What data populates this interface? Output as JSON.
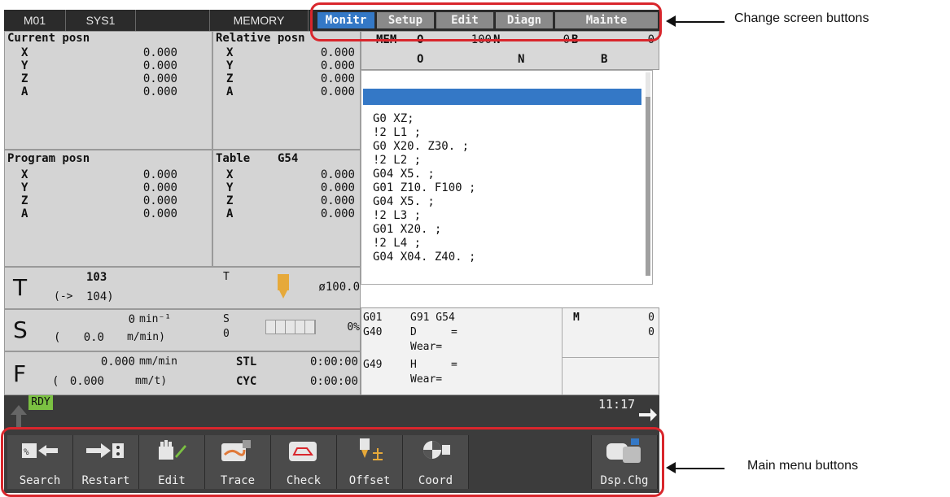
{
  "topbar": {
    "part": "M01",
    "system": "SYS1",
    "mode": "MEMORY",
    "screen_buttons": [
      "Monitr",
      "Setup",
      "Edit",
      "Diagn",
      "Mainte"
    ],
    "active_screen": "Monitr"
  },
  "current_posn": {
    "title": "Current posn",
    "axes": [
      "X",
      "Y",
      "Z",
      "A"
    ],
    "values": [
      "0.000",
      "0.000",
      "0.000",
      "0.000"
    ]
  },
  "relative_posn": {
    "title": "Relative posn",
    "axes": [
      "X",
      "Y",
      "Z",
      "A"
    ],
    "values": [
      "0.000",
      "0.000",
      "0.000",
      "0.000"
    ]
  },
  "program_posn": {
    "title": "Program posn",
    "axes": [
      "X",
      "Y",
      "Z",
      "A"
    ],
    "values": [
      "0.000",
      "0.000",
      "0.000",
      "0.000"
    ]
  },
  "table": {
    "title": "Table",
    "coord": "G54",
    "axes": [
      "X",
      "Y",
      "Z",
      "A"
    ],
    "values": [
      "0.000",
      "0.000",
      "0.000",
      "0.000"
    ]
  },
  "mem_header": {
    "mem": "MEM",
    "o1": "O",
    "o1_val": "100",
    "n1": "N",
    "n1_val": "0",
    "b1": "B",
    "b1_val": "0",
    "o2": "O",
    "n2": "N",
    "b2": "B"
  },
  "program_lines": [
    "G0 XZ;",
    "!2 L1 ;",
    "G0 X20. Z30. ;",
    "!2 L2 ;",
    "G04 X5. ;",
    "G01 Z10. F100 ;",
    "G04 X5. ;",
    "!2 L3 ;",
    "G01 X20. ;",
    "!2 L4 ;",
    "G04 X04. Z40. ;"
  ],
  "tool": {
    "letter": "T",
    "number": "103",
    "arrow": "(->",
    "next": "104)",
    "t_label": "T",
    "diameter": "ø100.0"
  },
  "spindle": {
    "letter": "S",
    "speed": "0",
    "unit": "min⁻¹",
    "paren_open": "(",
    "surface": "0.0",
    "surface_unit": "m/min)",
    "s_label": "S",
    "s_value": "0",
    "load": "0%"
  },
  "feed": {
    "letter": "F",
    "rate": "0.000",
    "rate_unit": "mm/min",
    "paren_open": "(",
    "per_rev": "0.000",
    "per_rev_unit": "mm/t)",
    "stl_label": "STL",
    "stl_time": "0:00:00",
    "cyc_label": "CYC",
    "cyc_time": "0:00:00"
  },
  "modal": {
    "g1": "G01",
    "g2": "G91 G54",
    "g40": "G40",
    "d": "D",
    "eq1": "=",
    "wear1": "Wear=",
    "g49": "G49",
    "h": "H",
    "eq2": "=",
    "wear2": "Wear=",
    "m": "M",
    "m1": "0",
    "m2": "0"
  },
  "status": {
    "ready": "RDY",
    "time": "11:17"
  },
  "menu": [
    "Search",
    "Restart",
    "Edit",
    "Trace",
    "Check",
    "Offset",
    "Coord",
    "Dsp.Chg"
  ],
  "annotations": {
    "top": "Change screen buttons",
    "bottom": "Main menu buttons"
  },
  "colors": {
    "active_tab": "#3478c6",
    "callout": "#d9262c",
    "ready": "#7bc142",
    "cursor": "#3478c6"
  }
}
